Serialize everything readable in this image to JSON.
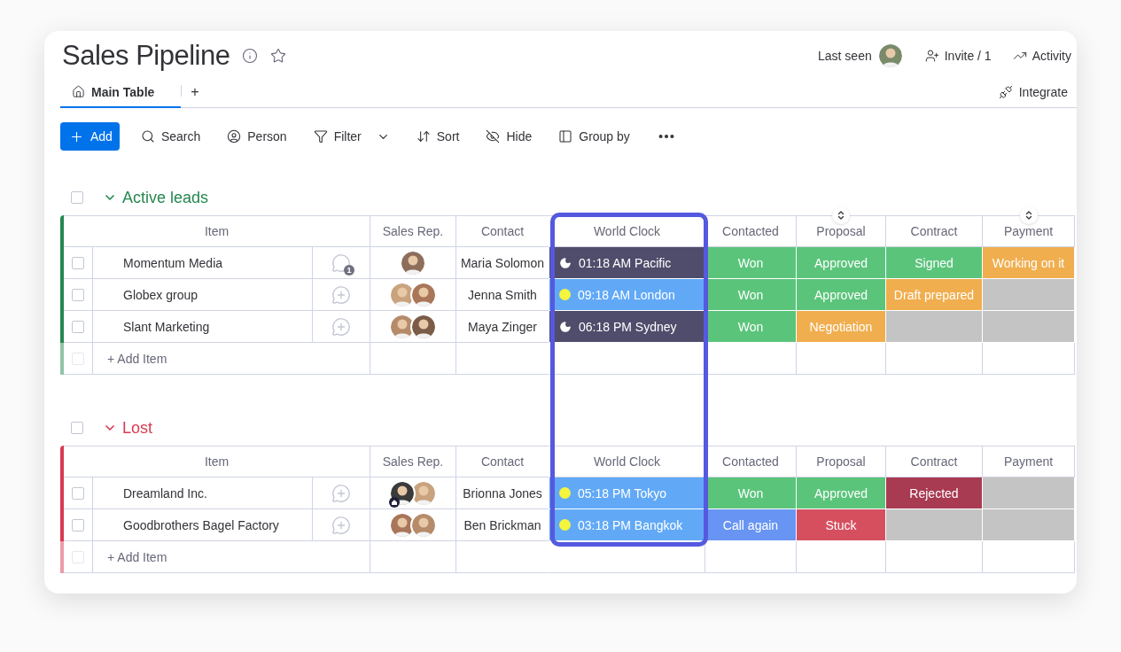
{
  "board": {
    "title": "Sales Pipeline"
  },
  "header_actions": {
    "last_seen": "Last seen",
    "invite": "Invite / 1",
    "activity": "Activity"
  },
  "tabs": [
    {
      "label": "Main Table",
      "selected": true
    }
  ],
  "add_tab": "+",
  "integrate": "Integrate",
  "toolbar": [
    {
      "kind": "primary",
      "label": "Add"
    },
    {
      "kind": "button",
      "label": "Search"
    },
    {
      "kind": "button",
      "label": "Person"
    },
    {
      "kind": "button",
      "label": "Filter",
      "dropdown": true
    },
    {
      "kind": "button",
      "label": "Sort"
    },
    {
      "kind": "button",
      "label": "Hide"
    },
    {
      "kind": "button",
      "label": "Group by"
    },
    {
      "kind": "more"
    }
  ],
  "groups": [
    {
      "title": "Active leads",
      "color": "#258750",
      "checked": false,
      "columns": [
        {
          "label": "Item",
          "sortable": false
        },
        {
          "label": "Sales Rep.",
          "sortable": false
        },
        {
          "label": "Contact",
          "sortable": false
        },
        {
          "label": "World Clock",
          "sortable": false
        },
        {
          "label": "Contacted",
          "sortable": false
        },
        {
          "label": "Proposal",
          "sortable": true
        },
        {
          "label": "Contract",
          "sortable": false
        },
        {
          "label": "Payment",
          "sortable": true
        }
      ],
      "rows": [
        {
          "checked": false,
          "name": "Momentum Media",
          "comments": "1",
          "reps": [
            {
              "home_badge": false
            }
          ],
          "contact": "Maria Solomon",
          "clock": {
            "time": "01:18 AM Pacific",
            "daytime": false
          },
          "statuses": [
            {
              "label": "Won",
              "color": "#5bc47b"
            },
            {
              "label": "Approved",
              "color": "#5bc47b"
            },
            {
              "label": "Signed",
              "color": "#5bc47b"
            },
            {
              "label": "Working on it",
              "color": "#f0ae4f"
            }
          ]
        },
        {
          "checked": false,
          "name": "Globex group",
          "reps": [
            {
              "home_badge": false
            },
            {
              "home_badge": false
            }
          ],
          "contact": "Jenna Smith",
          "clock": {
            "time": "09:18 AM London",
            "daytime": true
          },
          "statuses": [
            {
              "label": "Won",
              "color": "#5bc47b"
            },
            {
              "label": "Approved",
              "color": "#5bc47b"
            },
            {
              "label": "Draft prepared",
              "color": "#f0ae4f"
            },
            {
              "color": "#c4c4c4"
            }
          ]
        },
        {
          "checked": false,
          "name": "Slant Marketing",
          "reps": [
            {
              "home_badge": false
            },
            {
              "home_badge": false
            }
          ],
          "contact": "Maya Zinger",
          "clock": {
            "time": "06:18 PM Sydney",
            "daytime": false
          },
          "statuses": [
            {
              "label": "Won",
              "color": "#5bc47b"
            },
            {
              "label": "Negotiation",
              "color": "#f0ae4f"
            },
            {
              "color": "#c4c4c4"
            },
            {
              "color": "#c4c4c4"
            }
          ]
        }
      ],
      "add_item": {
        "label": "+ Add Item",
        "checked": false
      }
    },
    {
      "title": "Lost",
      "color": "#d83a52",
      "checked": false,
      "columns": [
        {
          "label": "Item",
          "sortable": false
        },
        {
          "label": "Sales Rep.",
          "sortable": false
        },
        {
          "label": "Contact",
          "sortable": false
        },
        {
          "label": "World Clock",
          "sortable": false
        },
        {
          "label": "Contacted",
          "sortable": false
        },
        {
          "label": "Proposal",
          "sortable": false
        },
        {
          "label": "Contract",
          "sortable": false
        },
        {
          "label": "Payment",
          "sortable": false
        }
      ],
      "rows": [
        {
          "checked": false,
          "name": "Dreamland Inc.",
          "reps": [
            {
              "home_badge": true
            },
            {
              "home_badge": false
            }
          ],
          "contact": "Brionna Jones",
          "clock": {
            "time": "05:18 PM Tokyo",
            "daytime": true
          },
          "statuses": [
            {
              "label": "Won",
              "color": "#5bc47b"
            },
            {
              "label": "Approved",
              "color": "#5bc47b"
            },
            {
              "label": "Rejected",
              "color": "#a83a52"
            },
            {
              "color": "#c4c4c4"
            }
          ]
        },
        {
          "checked": false,
          "name": "Goodbrothers Bagel Factory",
          "reps": [
            {
              "home_badge": false
            },
            {
              "home_badge": false
            }
          ],
          "contact": "Ben Brickman",
          "clock": {
            "time": "03:18 PM Bangkok",
            "daytime": true
          },
          "statuses": [
            {
              "label": "Call again",
              "color": "#6895f3"
            },
            {
              "label": "Stuck",
              "color": "#d64f5f"
            },
            {
              "color": "#c4c4c4"
            },
            {
              "color": "#c4c4c4"
            }
          ]
        }
      ],
      "add_item": {
        "label": "+ Add Item",
        "checked": false
      }
    }
  ]
}
